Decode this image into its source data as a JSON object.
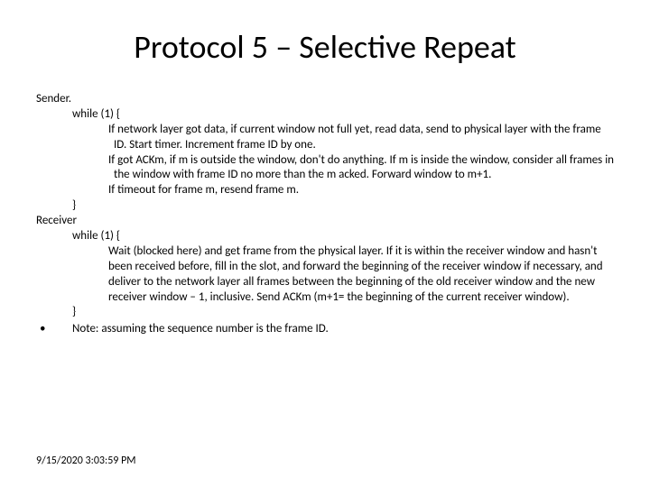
{
  "title": "Protocol 5 – Selective Repeat",
  "sender": {
    "heading": "Sender.",
    "loop_open": "while (1) {",
    "line1": "If network layer got data, if current window not full yet, read data, send to physical layer with the frame ID. Start timer. Increment frame ID by one.",
    "line2": "If got ACKm, if m is outside the window, don't do anything. If m is inside the window, consider all frames in the window with frame ID no more than the m acked. Forward window to m+1.",
    "line3": "If timeout for frame m, resend frame m.",
    "loop_close": "}"
  },
  "receiver": {
    "heading": "Receiver",
    "loop_open": "while (1) {",
    "line1": "Wait (blocked here) and get frame from the physical layer. If it is within the receiver window and hasn't been received before, fill in the slot, and forward the beginning of the receiver window if necessary, and deliver to the network layer all frames between the beginning of the old receiver window and the new receiver window – 1, inclusive. Send ACKm (m+1= the beginning of the current receiver window).",
    "loop_close": "}"
  },
  "note": {
    "bullet": "•",
    "text": "Note: assuming the sequence number is the frame ID."
  },
  "timestamp": "9/15/2020 3:03:59 PM"
}
